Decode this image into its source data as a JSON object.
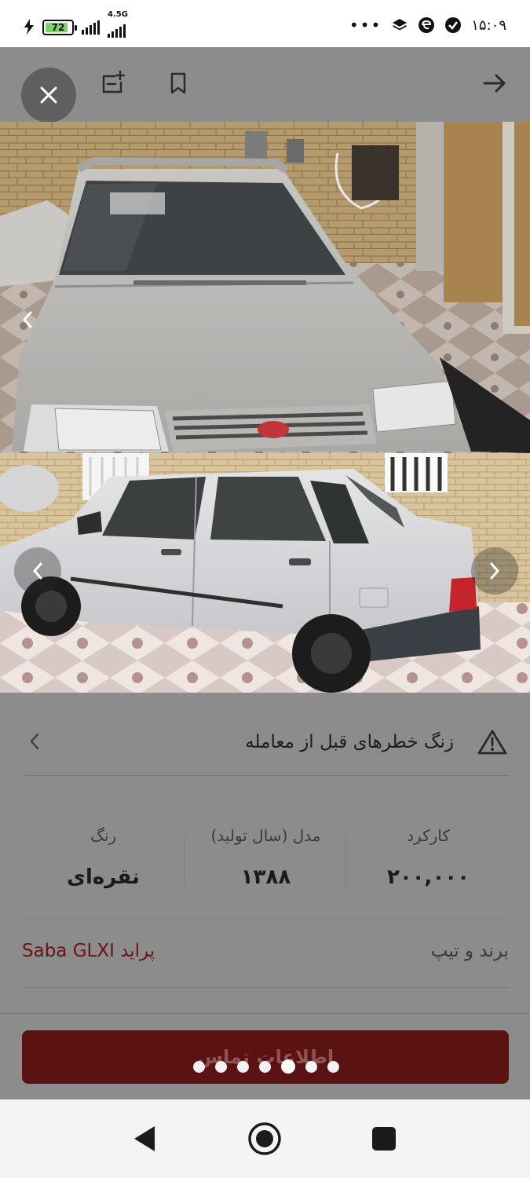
{
  "status_bar": {
    "battery_level": "72",
    "network_type": "4.5G",
    "time": "۱۵:۰۹",
    "icons": [
      "charging-bolt-icon",
      "battery-icon",
      "signal-icon",
      "signal-icon",
      "more-dots-icon",
      "layers-icon",
      "app-e-icon",
      "shield-check-icon"
    ]
  },
  "toolbar": {
    "icons": [
      "close-icon",
      "add-note-icon",
      "bookmark-icon",
      "arrow-right-icon"
    ]
  },
  "gallery": {
    "photos": [
      "car-front-photo",
      "car-side-photo"
    ],
    "prev_icon": "chevron-left-icon",
    "next_icon": "chevron-right-icon",
    "page_count": 7,
    "active_index": 4
  },
  "warning": {
    "text": "زنگ خطرهای قبل از معامله",
    "icon": "warning-triangle-icon"
  },
  "stats": [
    {
      "label": "کارکرد",
      "value": "۲۰۰,۰۰۰"
    },
    {
      "label": "مدل (سال تولید)",
      "value": "۱۳۸۸"
    },
    {
      "label": "رنگ",
      "value": "نقره‌ای"
    }
  ],
  "brand": {
    "label": "برند و تیپ",
    "value": "پراید Saba GLXI"
  },
  "cta": {
    "label": "اطلاعات تماس"
  },
  "colors": {
    "accent": "#7a1a1a",
    "overlay": "#8c8c8c"
  }
}
